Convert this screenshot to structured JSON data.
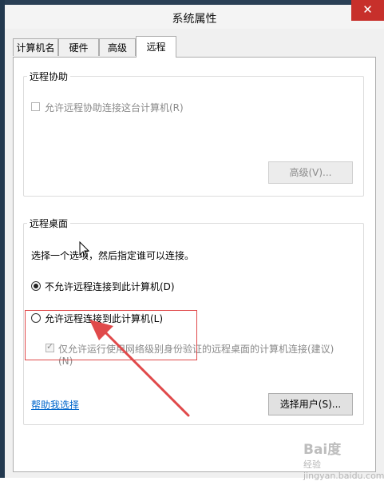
{
  "window": {
    "title": "系统属性",
    "close_glyph": "✕"
  },
  "tabs": [
    {
      "label": "计算机名"
    },
    {
      "label": "硬件"
    },
    {
      "label": "高级"
    },
    {
      "label": "远程",
      "active": true
    }
  ],
  "remote_assistance": {
    "group_title": "远程协助",
    "allow_checkbox_label": "允许远程协助连接这台计算机(R)",
    "allow_checked": false,
    "advanced_button": "高级(V)..."
  },
  "remote_desktop": {
    "group_title": "远程桌面",
    "instruction": "选择一个选项，然后指定谁可以连接。",
    "option_deny_label": "不允许远程连接到此计算机(D)",
    "option_allow_label": "允许远程连接到此计算机(L)",
    "selected_option": "deny",
    "nla_checkbox_label_line1": "仅允许运行使用网络级别身份验证的远程桌面的计算机连接(建议)",
    "nla_checkbox_label_line2": "(N)",
    "nla_checked": true,
    "help_link": "帮助我选择",
    "select_users_button": "选择用户(S)..."
  },
  "watermark": {
    "logo": "Bai度",
    "line1": "经验",
    "line2": "jingyan.baidu.com"
  },
  "colors": {
    "close_button": "#c7302b",
    "highlight": "#e0494a",
    "link": "#0066cc"
  }
}
